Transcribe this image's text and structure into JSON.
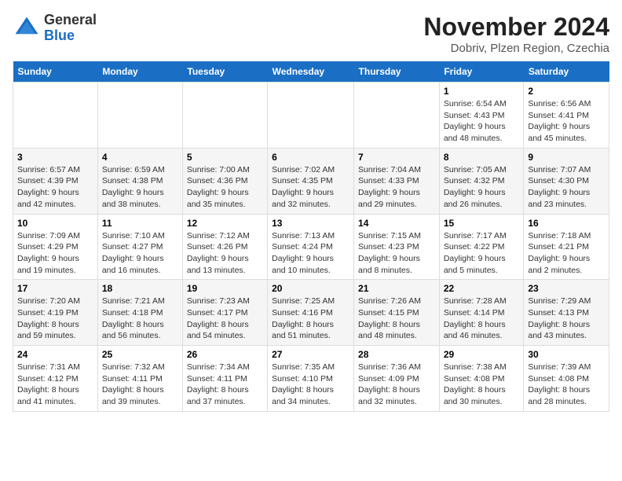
{
  "header": {
    "logo_general": "General",
    "logo_blue": "Blue",
    "title": "November 2024",
    "location": "Dobriv, Plzen Region, Czechia"
  },
  "days_of_week": [
    "Sunday",
    "Monday",
    "Tuesday",
    "Wednesday",
    "Thursday",
    "Friday",
    "Saturday"
  ],
  "weeks": [
    [
      {
        "day": "",
        "info": ""
      },
      {
        "day": "",
        "info": ""
      },
      {
        "day": "",
        "info": ""
      },
      {
        "day": "",
        "info": ""
      },
      {
        "day": "",
        "info": ""
      },
      {
        "day": "1",
        "info": "Sunrise: 6:54 AM\nSunset: 4:43 PM\nDaylight: 9 hours and 48 minutes."
      },
      {
        "day": "2",
        "info": "Sunrise: 6:56 AM\nSunset: 4:41 PM\nDaylight: 9 hours and 45 minutes."
      }
    ],
    [
      {
        "day": "3",
        "info": "Sunrise: 6:57 AM\nSunset: 4:39 PM\nDaylight: 9 hours and 42 minutes."
      },
      {
        "day": "4",
        "info": "Sunrise: 6:59 AM\nSunset: 4:38 PM\nDaylight: 9 hours and 38 minutes."
      },
      {
        "day": "5",
        "info": "Sunrise: 7:00 AM\nSunset: 4:36 PM\nDaylight: 9 hours and 35 minutes."
      },
      {
        "day": "6",
        "info": "Sunrise: 7:02 AM\nSunset: 4:35 PM\nDaylight: 9 hours and 32 minutes."
      },
      {
        "day": "7",
        "info": "Sunrise: 7:04 AM\nSunset: 4:33 PM\nDaylight: 9 hours and 29 minutes."
      },
      {
        "day": "8",
        "info": "Sunrise: 7:05 AM\nSunset: 4:32 PM\nDaylight: 9 hours and 26 minutes."
      },
      {
        "day": "9",
        "info": "Sunrise: 7:07 AM\nSunset: 4:30 PM\nDaylight: 9 hours and 23 minutes."
      }
    ],
    [
      {
        "day": "10",
        "info": "Sunrise: 7:09 AM\nSunset: 4:29 PM\nDaylight: 9 hours and 19 minutes."
      },
      {
        "day": "11",
        "info": "Sunrise: 7:10 AM\nSunset: 4:27 PM\nDaylight: 9 hours and 16 minutes."
      },
      {
        "day": "12",
        "info": "Sunrise: 7:12 AM\nSunset: 4:26 PM\nDaylight: 9 hours and 13 minutes."
      },
      {
        "day": "13",
        "info": "Sunrise: 7:13 AM\nSunset: 4:24 PM\nDaylight: 9 hours and 10 minutes."
      },
      {
        "day": "14",
        "info": "Sunrise: 7:15 AM\nSunset: 4:23 PM\nDaylight: 9 hours and 8 minutes."
      },
      {
        "day": "15",
        "info": "Sunrise: 7:17 AM\nSunset: 4:22 PM\nDaylight: 9 hours and 5 minutes."
      },
      {
        "day": "16",
        "info": "Sunrise: 7:18 AM\nSunset: 4:21 PM\nDaylight: 9 hours and 2 minutes."
      }
    ],
    [
      {
        "day": "17",
        "info": "Sunrise: 7:20 AM\nSunset: 4:19 PM\nDaylight: 8 hours and 59 minutes."
      },
      {
        "day": "18",
        "info": "Sunrise: 7:21 AM\nSunset: 4:18 PM\nDaylight: 8 hours and 56 minutes."
      },
      {
        "day": "19",
        "info": "Sunrise: 7:23 AM\nSunset: 4:17 PM\nDaylight: 8 hours and 54 minutes."
      },
      {
        "day": "20",
        "info": "Sunrise: 7:25 AM\nSunset: 4:16 PM\nDaylight: 8 hours and 51 minutes."
      },
      {
        "day": "21",
        "info": "Sunrise: 7:26 AM\nSunset: 4:15 PM\nDaylight: 8 hours and 48 minutes."
      },
      {
        "day": "22",
        "info": "Sunrise: 7:28 AM\nSunset: 4:14 PM\nDaylight: 8 hours and 46 minutes."
      },
      {
        "day": "23",
        "info": "Sunrise: 7:29 AM\nSunset: 4:13 PM\nDaylight: 8 hours and 43 minutes."
      }
    ],
    [
      {
        "day": "24",
        "info": "Sunrise: 7:31 AM\nSunset: 4:12 PM\nDaylight: 8 hours and 41 minutes."
      },
      {
        "day": "25",
        "info": "Sunrise: 7:32 AM\nSunset: 4:11 PM\nDaylight: 8 hours and 39 minutes."
      },
      {
        "day": "26",
        "info": "Sunrise: 7:34 AM\nSunset: 4:11 PM\nDaylight: 8 hours and 37 minutes."
      },
      {
        "day": "27",
        "info": "Sunrise: 7:35 AM\nSunset: 4:10 PM\nDaylight: 8 hours and 34 minutes."
      },
      {
        "day": "28",
        "info": "Sunrise: 7:36 AM\nSunset: 4:09 PM\nDaylight: 8 hours and 32 minutes."
      },
      {
        "day": "29",
        "info": "Sunrise: 7:38 AM\nSunset: 4:08 PM\nDaylight: 8 hours and 30 minutes."
      },
      {
        "day": "30",
        "info": "Sunrise: 7:39 AM\nSunset: 4:08 PM\nDaylight: 8 hours and 28 minutes."
      }
    ]
  ]
}
